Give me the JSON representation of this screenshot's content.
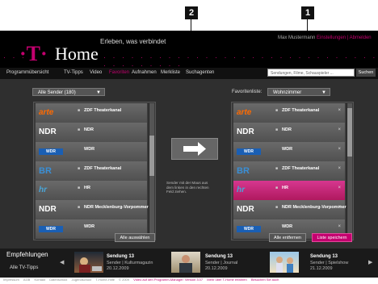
{
  "callouts": [
    "2",
    "1"
  ],
  "header": {
    "logo_t": "·T·",
    "brand": "Home",
    "slogan": "Erleben, was verbindet",
    "user_greeting": "Max Mustermann",
    "user_links": "Einstellungen | Abmelden"
  },
  "menu": {
    "items": [
      "Programmübersicht",
      "TV-Tipps",
      "Video",
      "Favoriten",
      "Aufnahmen",
      "Merkliste",
      "Suchagenten"
    ],
    "active_index": 3
  },
  "search": {
    "placeholder": "Sendungen, Filme, Schauspieler ...",
    "button": "Suchen"
  },
  "left": {
    "dropdown": "Alle Sender (180)",
    "rows": [
      {
        "logo": "arte",
        "name": "ZDF Theaterkanal"
      },
      {
        "logo": "NDR",
        "name": "NDR"
      },
      {
        "logo": "WDR",
        "name": "WDR"
      },
      {
        "logo": "BR",
        "name": "ZDF Theaterkanal"
      },
      {
        "logo": "hr",
        "name": "HR"
      },
      {
        "logo": "NDR",
        "name": "NDR Mecklenburg-Vorpommern"
      },
      {
        "logo": "WDR",
        "name": "WDR"
      }
    ],
    "select_all": "Alle auswählen"
  },
  "hint": "Sender mit der Maus aus dem linken in den rechten Feld ziehen.",
  "right": {
    "label": "Favoritenliste:",
    "dropdown": "Wohnzimmer",
    "rows": [
      {
        "logo": "arte",
        "name": "ZDF Theaterkanal",
        "selected": false
      },
      {
        "logo": "NDR",
        "name": "NDR",
        "selected": false
      },
      {
        "logo": "WDR",
        "name": "WDR",
        "selected": false
      },
      {
        "logo": "BR",
        "name": "ZDF Theaterkanal",
        "selected": false
      },
      {
        "logo": "hr",
        "name": "HR",
        "selected": true
      },
      {
        "logo": "NDR",
        "name": "NDR Mecklenburg-Vorpommern",
        "selected": false
      },
      {
        "logo": "WDR",
        "name": "WDR",
        "selected": false
      }
    ],
    "remove_all": "Alle entfernen",
    "save": "Liste speichern"
  },
  "tips": {
    "heading": "Empfehlungen",
    "all_tips": "Alle TV-Tipps",
    "items": [
      {
        "title": "Sendung 13",
        "sub1": "Sender | Kulturmagazin",
        "sub2": "20.12.2009"
      },
      {
        "title": "Sendung 13",
        "sub1": "Sender | Journal",
        "sub2": "20.12.2009"
      },
      {
        "title": "Sendung 13",
        "sub1": "Sender | Spielshow",
        "sub2": "21.12.2009"
      }
    ]
  },
  "footer": {
    "links": [
      "Impressum",
      "AGB",
      "Kontakt",
      "Datenschutz",
      "Jugendschutz",
      "T-Home-Hilfe",
      "© 2009"
    ],
    "promo": "Video auf den Programm-Manager: Version 3.07",
    "promo2": "Mehr über T-Home erfahren",
    "right": "Besuchen Sie auch"
  }
}
